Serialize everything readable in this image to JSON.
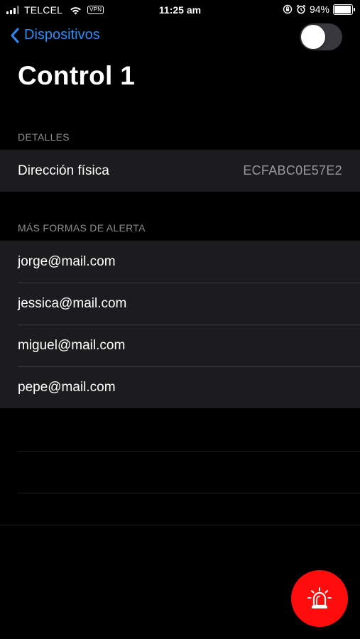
{
  "status_bar": {
    "carrier": "TELCEL",
    "vpn": "VPN",
    "time": "11:25 am",
    "battery_percent": "94%",
    "battery_level": 0.94
  },
  "nav": {
    "back_label": "Dispositivos",
    "toggle_on": false
  },
  "page": {
    "title": "Control 1"
  },
  "details": {
    "header": "DETALLES",
    "rows": [
      {
        "label": "Dirección física",
        "value": "ECFABC0E57E2"
      }
    ]
  },
  "alerts": {
    "header": "MÁS FORMAS DE ALERTA",
    "emails": [
      "jorge@mail.com",
      "jessica@mail.com",
      "miguel@mail.com",
      "pepe@mail.com"
    ]
  },
  "colors": {
    "accent": "#2f8cf5",
    "alarm": "#ff0d0d",
    "background": "#000000",
    "cell": "#1c1c1e"
  },
  "icons": {
    "back": "chevron-left-icon",
    "alarm": "siren-icon"
  }
}
